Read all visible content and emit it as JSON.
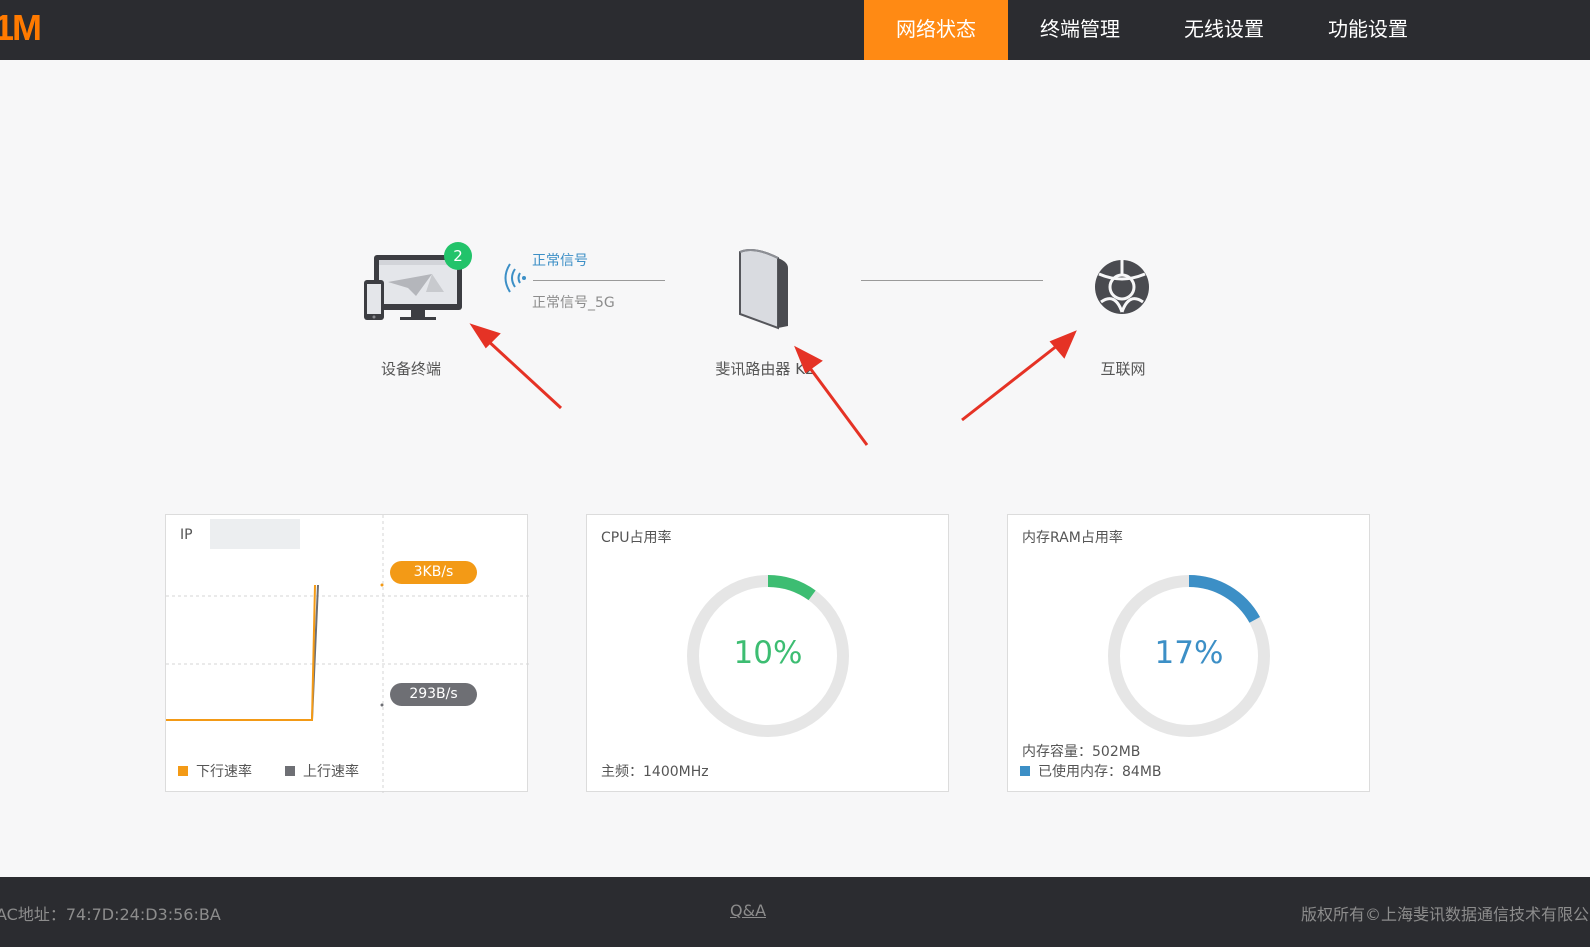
{
  "header": {
    "logo_text": "1M",
    "nav": [
      {
        "label": "网络状态",
        "active": true
      },
      {
        "label": "终端管理",
        "active": false
      },
      {
        "label": "无线设置",
        "active": false
      },
      {
        "label": "功能设置",
        "active": false
      }
    ]
  },
  "topology": {
    "devices_label": "设备终端",
    "devices_count": "2",
    "signal_24": "正常信号",
    "signal_5g": "正常信号_5G",
    "router_label": "斐讯路由器 K2",
    "internet_label": "互联网"
  },
  "traffic_card": {
    "title": "IP",
    "download_rate": "3KB/s",
    "upload_rate": "293B/s",
    "legend_download": "下行速率",
    "legend_upload": "上行速率",
    "colors": {
      "download": "#f39a16",
      "upload": "#6e6f74"
    }
  },
  "cpu_card": {
    "title": "CPU占用率",
    "percent_text": "10%",
    "percent": 10,
    "freq_label": "主频：1400MHz",
    "color": "#3dbd72"
  },
  "ram_card": {
    "title": "内存RAM占用率",
    "percent_text": "17%",
    "percent": 17,
    "capacity_label": "内存容量：502MB",
    "used_label": "已使用内存：84MB",
    "color": "#3c8fc6"
  },
  "footer": {
    "mac": "AC地址：74:7D:24:D3:56:BA",
    "qa": "Q&A",
    "copyright": "版权所有©上海斐讯数据通信技术有限公司"
  }
}
